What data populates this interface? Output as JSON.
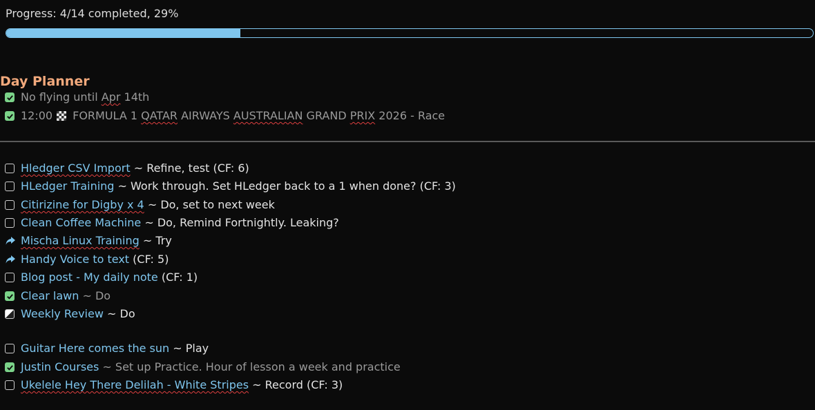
{
  "progress": {
    "label": "Progress: 4/14 completed, 29%",
    "fraction": 0.29,
    "accent": "#7fc6ee"
  },
  "planner": {
    "title": "Day Planner",
    "items": [
      {
        "state": "done",
        "pre": "No flying until ",
        "squiggle": "Apr",
        "post": " 14th"
      },
      {
        "state": "done",
        "time": "12:00",
        "icon": "chequered-flag-icon",
        "pre": "FORMULA 1 ",
        "sq1": "QATAR",
        "mid1": " AIRWAYS ",
        "sq2": "AUSTRALIAN",
        "mid2": " GRAND ",
        "sq3": "PRIX",
        "post": " 2026 - Race"
      }
    ]
  },
  "tasks": [
    {
      "state": "todo",
      "link": "Hledger CSV Import",
      "rest": " ~ Refine, test (CF: 6)"
    },
    {
      "state": "todo",
      "link": "HLedger Training",
      "rest": " ~ Work through. Set HLedger back to a 1 when done? (CF: 3)"
    },
    {
      "state": "todo",
      "link": "Citirizine for Digby x 4",
      "rest": " ~ Do, set to next week"
    },
    {
      "state": "todo",
      "link": "Clean Coffee Machine",
      "rest": " ~ Do, Remind Fortnightly. Leaking?"
    },
    {
      "state": "forwarded",
      "link": "Mischa Linux Training",
      "rest": " ~ Try"
    },
    {
      "state": "forwarded",
      "link": "Handy Voice to text",
      "rest": " (CF: 5)"
    },
    {
      "state": "todo",
      "link": "Blog post - My daily note",
      "rest": " (CF: 1)"
    },
    {
      "state": "done",
      "link": "Clear lawn",
      "rest": " ~ Do"
    },
    {
      "state": "partial",
      "link": "Weekly Review",
      "rest": " ~ Do"
    },
    {
      "state": "todo",
      "link": "Guitar Here comes the sun",
      "rest": " ~ Play"
    },
    {
      "state": "done",
      "link": "Justin Courses",
      "rest": " ~ Set up Practice. Hour of lesson a week and practice"
    },
    {
      "state": "todo",
      "link": "Ukelele Hey There Delilah - White Stripes",
      "rest": " ~ Record (CF: 3)"
    }
  ]
}
